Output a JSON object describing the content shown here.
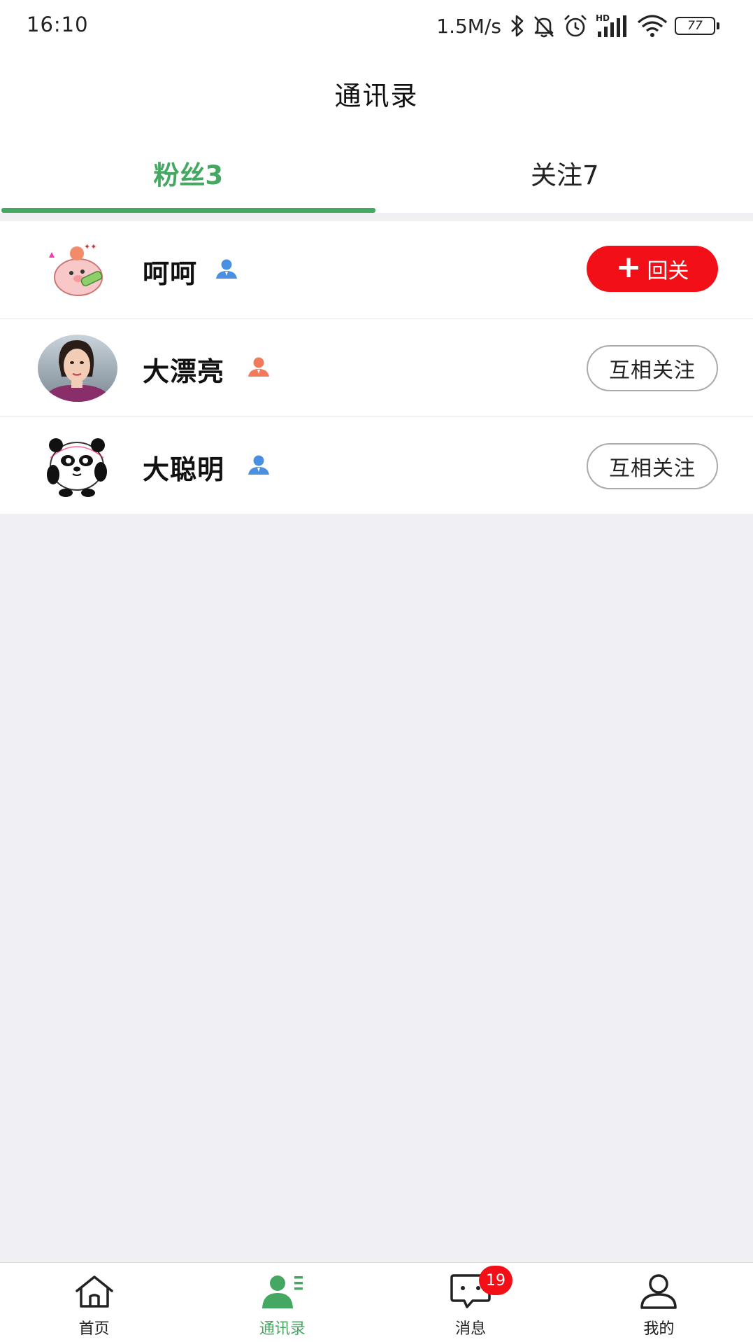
{
  "status_bar": {
    "time": "16:10",
    "net_speed": "1.5M/s",
    "signal_label": "HD",
    "battery": "77"
  },
  "header": {
    "title": "通讯录"
  },
  "tabs": [
    {
      "label": "粉丝3",
      "active": true
    },
    {
      "label": "关注7",
      "active": false
    }
  ],
  "users": [
    {
      "name": "呵呵",
      "badge_color": "#4a90e2",
      "action": "回关",
      "action_type": "follow-back"
    },
    {
      "name": "大漂亮",
      "badge_color": "#f07a5a",
      "action": "互相关注",
      "action_type": "mutual"
    },
    {
      "name": "大聪明",
      "badge_color": "#4a90e2",
      "action": "互相关注",
      "action_type": "mutual"
    }
  ],
  "bottom_nav": [
    {
      "label": "首页",
      "icon": "home-icon",
      "active": false
    },
    {
      "label": "通讯录",
      "icon": "contacts-icon",
      "active": true
    },
    {
      "label": "消息",
      "icon": "message-icon",
      "active": false,
      "badge": "19"
    },
    {
      "label": "我的",
      "icon": "profile-icon",
      "active": false
    }
  ],
  "colors": {
    "accent": "#45a862",
    "follow_back": "#f20f18",
    "background": "#efeff4"
  }
}
